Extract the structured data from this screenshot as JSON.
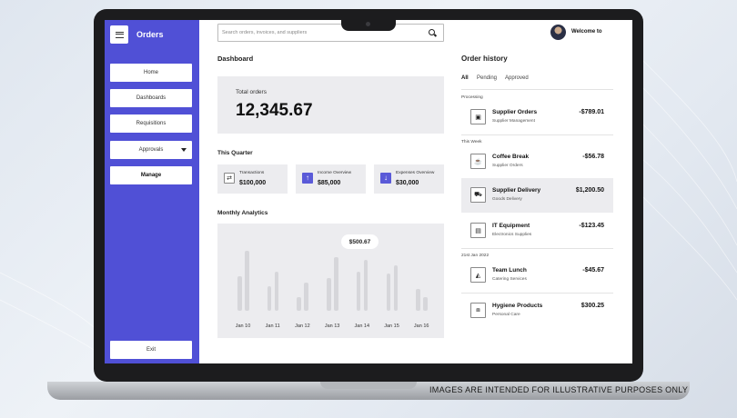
{
  "sidebar": {
    "brand": "Orders",
    "nav": [
      {
        "label": "Home"
      },
      {
        "label": "Dashboards"
      },
      {
        "label": "Requisitions"
      },
      {
        "label": "Approvals"
      },
      {
        "label": "Manage"
      }
    ],
    "exit_label": "Exit"
  },
  "header": {
    "search_placeholder": "Search orders, invoices, and suppliers",
    "welcome": "Welcome to"
  },
  "dashboard": {
    "title": "Dashboard",
    "total_label": "Total orders",
    "total_value": "12,345.67",
    "quarter_title": "This Quarter",
    "quarter_cards": [
      {
        "title": "Transactions",
        "value": "$100,000",
        "icon": "swap-icon"
      },
      {
        "title": "Income Overview",
        "value": "$85,000",
        "icon": "arrow-up-icon"
      },
      {
        "title": "Expenses Overview",
        "value": "$30,000",
        "icon": "arrow-down-icon"
      }
    ],
    "analytics_title": "Monthly Analytics"
  },
  "chart_data": {
    "type": "bar",
    "categories": [
      "Jan 10",
      "Jan 11",
      "Jan 12",
      "Jan 13",
      "Jan 14",
      "Jan 15",
      "Jan 16"
    ],
    "series": [
      {
        "values": [
          0.55,
          0.38,
          0.22,
          0.52,
          0.62,
          0.58,
          0.35
        ]
      },
      {
        "values": [
          0.95,
          0.62,
          0.45,
          0.85,
          0.8,
          0.72,
          0.22
        ]
      }
    ],
    "tooltip": "$500.67",
    "ylim": [
      0,
      1
    ]
  },
  "order_history": {
    "title": "Order history",
    "tabs": [
      "All",
      "Pending",
      "Approved"
    ],
    "groups": [
      {
        "label": "Processing"
      },
      {
        "label": "This Week"
      },
      {
        "label": "21st Jan 2022"
      }
    ],
    "rows": [
      {
        "name": "Supplier Orders",
        "sub": "Supplier Management",
        "amount": "-$789.01",
        "icon": "box-icon"
      },
      {
        "name": "Coffee Break",
        "sub": "Supplier Orders",
        "amount": "-$56.78",
        "icon": "coffee-icon"
      },
      {
        "name": "Supplier Delivery",
        "sub": "Goods Delivery",
        "amount": "$1,200.50",
        "icon": "cart-icon"
      },
      {
        "name": "IT Equipment",
        "sub": "Electronics Supplies",
        "amount": "-$123.45",
        "icon": "device-icon"
      },
      {
        "name": "Team Lunch",
        "sub": "Catering Services",
        "amount": "-$45.67",
        "icon": "food-icon"
      },
      {
        "name": "Hygiene Products",
        "sub": "Personal Care",
        "amount": "$300.25",
        "icon": "bottle-icon"
      }
    ]
  },
  "disclaimer": "IMAGES ARE INTENDED FOR ILLUSTRATIVE PURPOSES ONLY"
}
